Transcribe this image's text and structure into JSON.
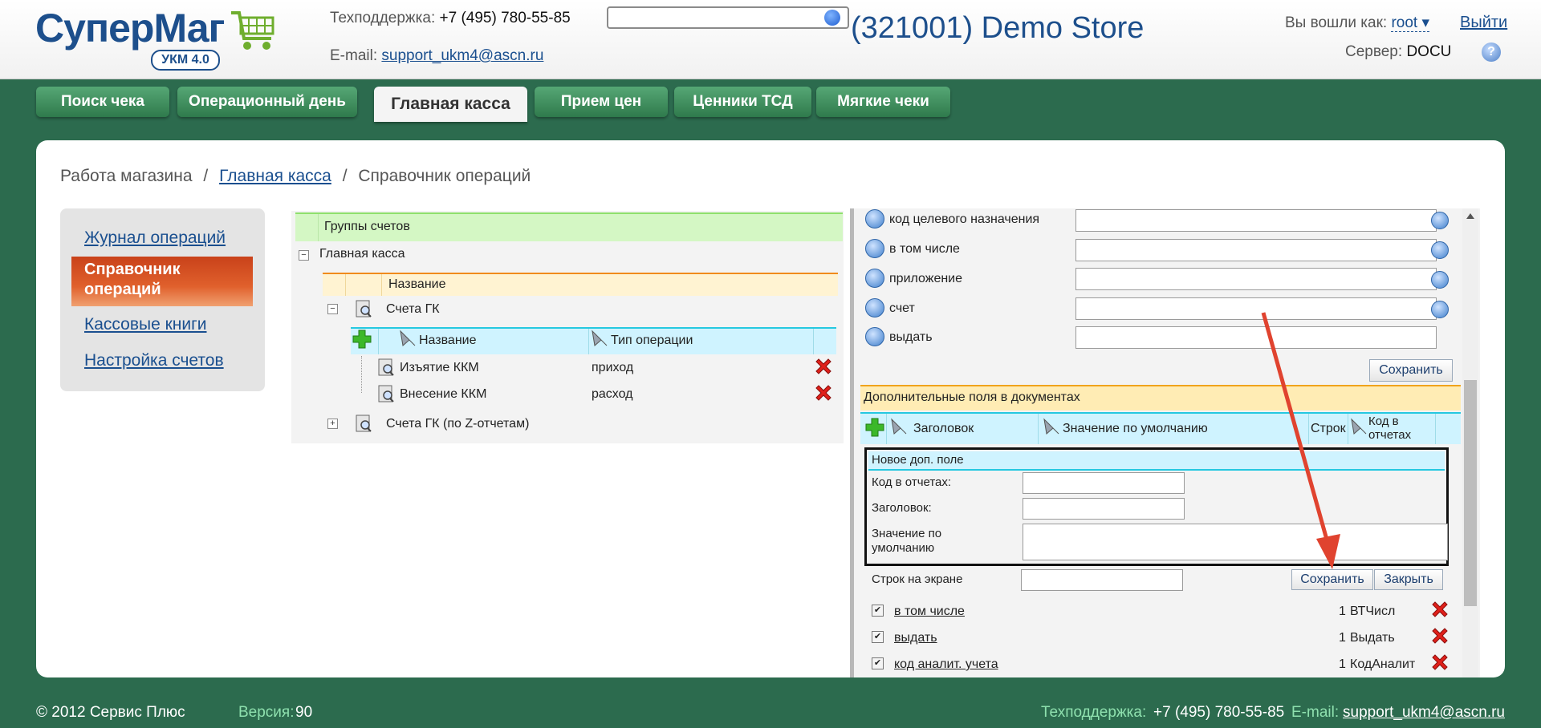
{
  "header": {
    "logo_text": "СуперМаг",
    "logo_badge": "УКМ 4.0",
    "support_label": "Техподдержка:",
    "support_phone": "+7 (495) 780-55-85",
    "email_label": "E-mail:",
    "email": "support_ukm4@ascn.ru",
    "search_value": "",
    "store_title": "(321001) Demo Store",
    "logged_in_label": "Вы вошли как:",
    "user": "root",
    "logout": "Выйти",
    "server_label": "Сервер:",
    "server": "DOCU"
  },
  "tabs": [
    {
      "label": "Поиск чека"
    },
    {
      "label": "Операционный день"
    },
    {
      "label": "Главная касса"
    },
    {
      "label": "Прием цен"
    },
    {
      "label": "Ценники ТСД"
    },
    {
      "label": "Мягкие чеки"
    }
  ],
  "breadcrumb": {
    "root": "Работа магазина",
    "link": "Главная касса",
    "current": "Справочник операций",
    "separator": "/"
  },
  "sidebar": {
    "items": [
      {
        "label": "Журнал операций",
        "active": false
      },
      {
        "label": "Справочник операций",
        "active": true
      },
      {
        "label": "Кассовые книги",
        "active": false
      },
      {
        "label": "Настройка счетов",
        "active": false
      }
    ]
  },
  "tree": {
    "group_header": "Группы счетов",
    "root_node": "Главная касса",
    "name_header": "Название",
    "node1": "Счета ГК",
    "col_name": "Название",
    "col_type": "Тип операции",
    "ops": [
      {
        "name": "Изъятие ККМ",
        "type": "приход"
      },
      {
        "name": "Внесение ККМ",
        "type": "расход"
      }
    ],
    "node2": "Счета ГК (по Z-отчетам)"
  },
  "right": {
    "fields": [
      {
        "label": "код целевого назначения"
      },
      {
        "label": "в том числе"
      },
      {
        "label": "приложение"
      },
      {
        "label": "счет"
      },
      {
        "label": "выдать"
      }
    ],
    "save": "Сохранить",
    "section_title": "Дополнительные поля в документах",
    "col_title": "Заголовок",
    "col_default": "Значение по умолчанию",
    "col_rows": "Строк",
    "col_code": "Код в отчетах",
    "form": {
      "title": "Новое доп. поле",
      "code_label": "Код в отчетах:",
      "title_label": "Заголовок:",
      "default_label": "Значение по умолчанию",
      "rows_label": "Строк на экране",
      "save": "Сохранить",
      "close": "Закрыть"
    },
    "list": [
      {
        "name": "в том числе",
        "rows": "1",
        "code": "ВТЧисл",
        "checked": true
      },
      {
        "name": "выдать",
        "rows": "1",
        "code": "Выдать",
        "checked": true
      },
      {
        "name": "код аналит. учета",
        "rows": "1",
        "code": "КодАналит",
        "checked": true
      }
    ]
  },
  "footer": {
    "copyright": "© 2012 Сервис Плюс",
    "version_label": "Версия:",
    "version": "90",
    "support_label": "Техподдержка:",
    "support_phone": "+7 (495) 780-55-85",
    "email_label": "E-mail:",
    "email": "support_ukm4@ascn.ru"
  },
  "colors": {
    "brand": "#1d4f8c",
    "background": "#2c6b4e",
    "tab": "#3f8f5d",
    "active_sidebar": "#d6501f",
    "annotation_arrow": "#e0432f"
  }
}
